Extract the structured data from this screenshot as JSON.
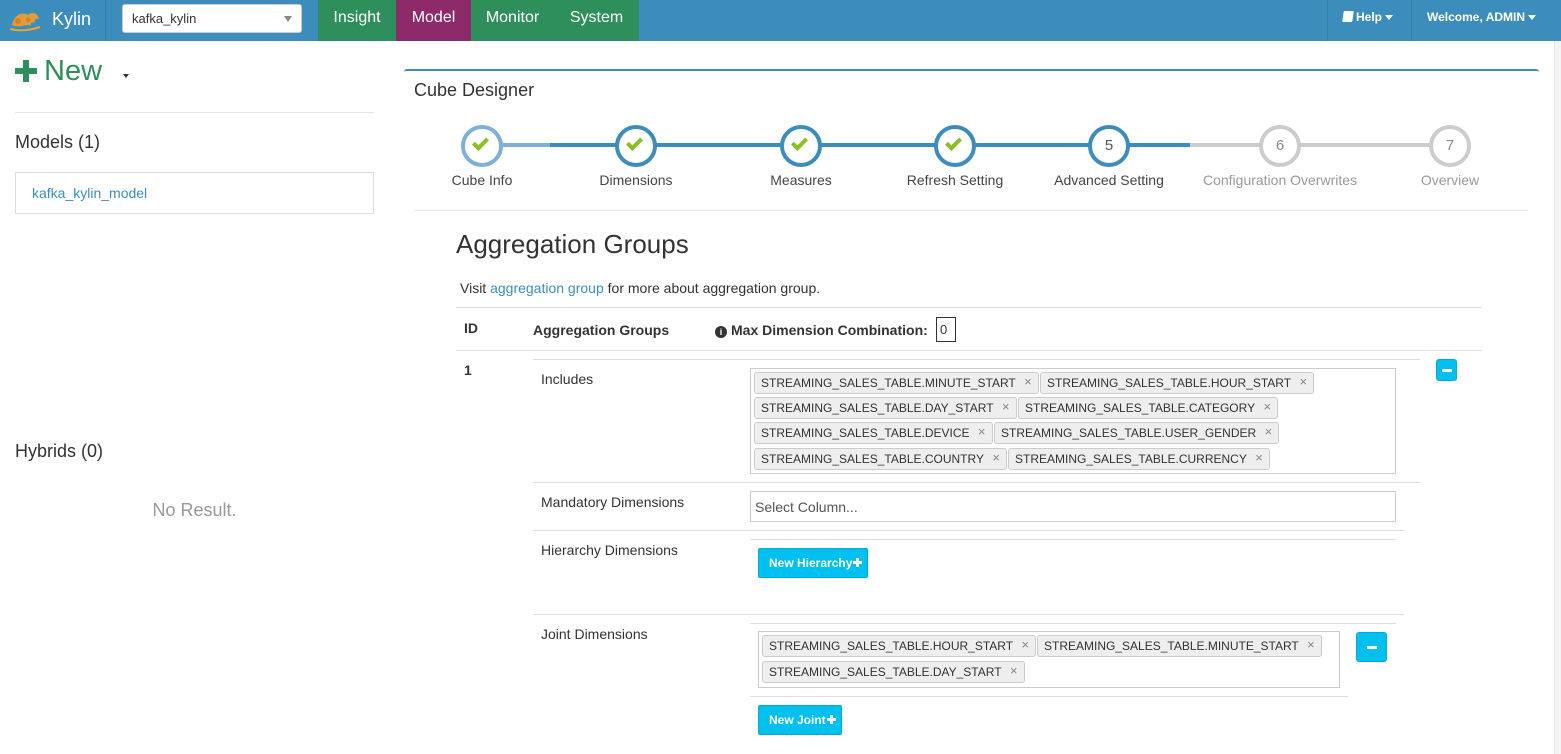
{
  "header": {
    "brand": "Kylin",
    "project": "kafka_kylin",
    "nav": [
      "Insight",
      "Model",
      "Monitor",
      "System"
    ],
    "active_nav": "Model",
    "help": "Help",
    "welcome": "Welcome, ADMIN"
  },
  "sidebar": {
    "new_label": "New",
    "models_heading": "Models (1)",
    "models": [
      "kafka_kylin_model"
    ],
    "hybrids_heading": "Hybrids (0)",
    "no_result": "No Result."
  },
  "designer": {
    "title": "Cube Designer",
    "steps": [
      {
        "number": "1",
        "label": "Cube Info",
        "status": "complete"
      },
      {
        "number": "2",
        "label": "Dimensions",
        "status": "complete"
      },
      {
        "number": "3",
        "label": "Measures",
        "status": "complete"
      },
      {
        "number": "4",
        "label": "Refresh Setting",
        "status": "complete"
      },
      {
        "number": "5",
        "label": "Advanced Setting",
        "status": "current"
      },
      {
        "number": "6",
        "label": "Configuration Overwrites",
        "status": "pending"
      },
      {
        "number": "7",
        "label": "Overview",
        "status": "pending"
      }
    ]
  },
  "aggregation": {
    "title": "Aggregation Groups",
    "visit_prefix": "Visit",
    "visit_link": "aggregation group",
    "visit_suffix": "for more about aggregation group.",
    "col_id": "ID",
    "col_groups": "Aggregation Groups",
    "col_max": "Max Dimension Combination:",
    "max_value": "0",
    "group": {
      "id": "1",
      "includes_label": "Includes",
      "includes": [
        "STREAMING_SALES_TABLE.MINUTE_START",
        "STREAMING_SALES_TABLE.HOUR_START",
        "STREAMING_SALES_TABLE.DAY_START",
        "STREAMING_SALES_TABLE.CATEGORY",
        "STREAMING_SALES_TABLE.DEVICE",
        "STREAMING_SALES_TABLE.USER_GENDER",
        "STREAMING_SALES_TABLE.COUNTRY",
        "STREAMING_SALES_TABLE.CURRENCY"
      ],
      "mandatory_label": "Mandatory Dimensions",
      "mandatory_placeholder": "Select Column...",
      "hierarchy_label": "Hierarchy Dimensions",
      "new_hierarchy": "New Hierarchy",
      "joint_label": "Joint Dimensions",
      "joint": [
        "STREAMING_SALES_TABLE.HOUR_START",
        "STREAMING_SALES_TABLE.MINUTE_START",
        "STREAMING_SALES_TABLE.DAY_START"
      ],
      "new_joint": "New Joint"
    }
  },
  "colors": {
    "header_blue": "#3c8dbc",
    "nav_green": "#2e8f5c",
    "nav_active": "#8e2a6a",
    "button_cyan": "#00c0ef",
    "check_green": "#8cbf26"
  }
}
